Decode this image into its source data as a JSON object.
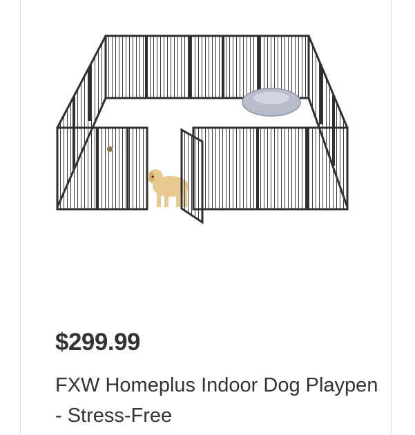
{
  "product": {
    "price": "$299.99",
    "title": "FXW Homeplus Indoor Dog Playpen - Stress-Free",
    "image_icon": "dog-playpen-image"
  },
  "colors": {
    "text": "#333333",
    "card_border": "#dcdcdc",
    "fence": "#2f2f2f",
    "bed": "#b8bccb",
    "dog": "#e8c98f"
  }
}
